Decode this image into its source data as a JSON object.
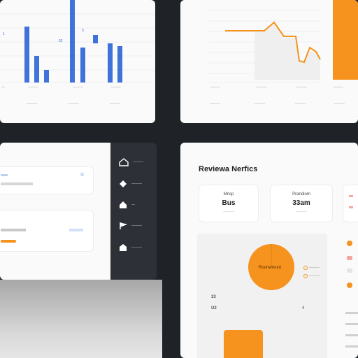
{
  "top_left_chart": {
    "x_labels": [
      "—",
      "———",
      "———",
      "———"
    ],
    "footer_labels": [
      "———",
      "———",
      "———"
    ],
    "marker_labels": [
      "1",
      "52",
      "5"
    ]
  },
  "top_right_chart": {
    "x_labels": [
      "———",
      "———",
      "———",
      "———"
    ],
    "footer_labels": [
      "———",
      "———",
      "———",
      "———"
    ]
  },
  "sidebar": {
    "items": [
      {
        "icon": "home-icon",
        "label": "———"
      },
      {
        "icon": "tag-icon",
        "label": "———"
      },
      {
        "icon": "home-icon",
        "label": "—"
      },
      {
        "icon": "flag-icon",
        "label": "———"
      },
      {
        "icon": "house-icon",
        "label": "———"
      }
    ]
  },
  "review": {
    "title": "Reviewa Nerfics",
    "kpis": [
      {
        "label": "Mnsp",
        "value": "Bus",
        "sub": "————"
      },
      {
        "label": "Prandiom",
        "value": "33am",
        "sub": "————"
      }
    ],
    "donut_label": "Roonwmunt",
    "legend": [
      "———",
      "———"
    ],
    "left_values": [
      "33",
      "U2"
    ],
    "right_marker": "4"
  },
  "colors": {
    "blue": "#3f73d9",
    "orange": "#f5931e",
    "dark": "#2d3137",
    "background": "#1f2226"
  }
}
